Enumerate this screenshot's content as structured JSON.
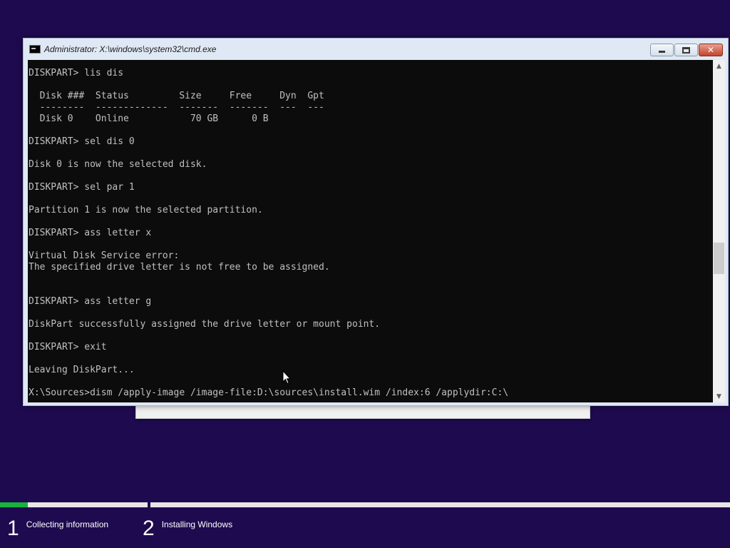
{
  "window": {
    "title": "Administrator: X:\\windows\\system32\\cmd.exe",
    "icon": "console-icon",
    "controls": {
      "minimize": "minimize-icon",
      "maximize": "maximize-icon",
      "close": "close-icon",
      "close_glyph": "✕"
    }
  },
  "console": {
    "lines": [
      "DISKPART> lis dis",
      "",
      "  Disk ###  Status         Size     Free     Dyn  Gpt",
      "  --------  -------------  -------  -------  ---  ---",
      "  Disk 0    Online           70 GB      0 B",
      "",
      "DISKPART> sel dis 0",
      "",
      "Disk 0 is now the selected disk.",
      "",
      "DISKPART> sel par 1",
      "",
      "Partition 1 is now the selected partition.",
      "",
      "DISKPART> ass letter x",
      "",
      "Virtual Disk Service error:",
      "The specified drive letter is not free to be assigned.",
      "",
      "",
      "DISKPART> ass letter g",
      "",
      "DiskPart successfully assigned the drive letter or mount point.",
      "",
      "DISKPART> exit",
      "",
      "Leaving DiskPart...",
      "",
      "X:\\Sources>dism /apply-image /image-file:D:\\sources\\install.wim /index:6 /applydir:C:\\"
    ]
  },
  "scrollbar": {
    "up_glyph": "▲",
    "down_glyph": "▼"
  },
  "setup_steps": [
    {
      "number": "1",
      "label": "Collecting information",
      "progress": 0.19
    },
    {
      "number": "2",
      "label": "Installing Windows",
      "progress": 0
    }
  ],
  "colors": {
    "desktop_bg": "#1e0a4f",
    "console_bg": "#0c0c0c",
    "console_text": "#c0c0c0",
    "progress_fill": "#17b33c"
  }
}
